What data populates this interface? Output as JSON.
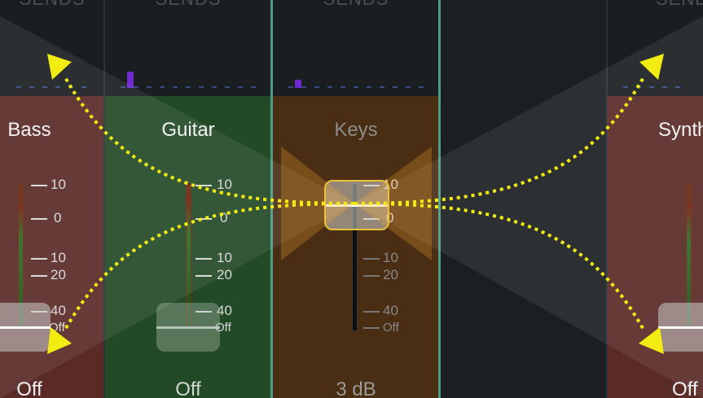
{
  "channels": [
    {
      "id": "bass",
      "name": "Bass",
      "gain": "Off",
      "sends": "SENDS"
    },
    {
      "id": "guitar",
      "name": "Guitar",
      "gain": "Off",
      "sends": "SENDS"
    },
    {
      "id": "keys",
      "name": "Keys",
      "gain": "3 dB",
      "sends": "SENDS"
    },
    {
      "id": "synth",
      "name": "Synth",
      "gain": "Off",
      "sends": "SENDS"
    }
  ],
  "scale": {
    "t10": "10",
    "t0": "0",
    "m10": "10",
    "m20": "20",
    "m40": "40",
    "off": "Off"
  },
  "colors": {
    "bass_bg": "#5a2a26",
    "guitar_bg": "#234a26",
    "keys_bg": "#4a2e14",
    "synth_bg": "#5a2a26",
    "gesture": "#f2ec12",
    "selected_outline": "#e6c23a",
    "divider": "#4f9c86"
  },
  "icons": [
    "arrow-up-left-icon",
    "arrow-down-left-icon",
    "arrow-up-right-icon",
    "arrow-down-right-icon"
  ]
}
